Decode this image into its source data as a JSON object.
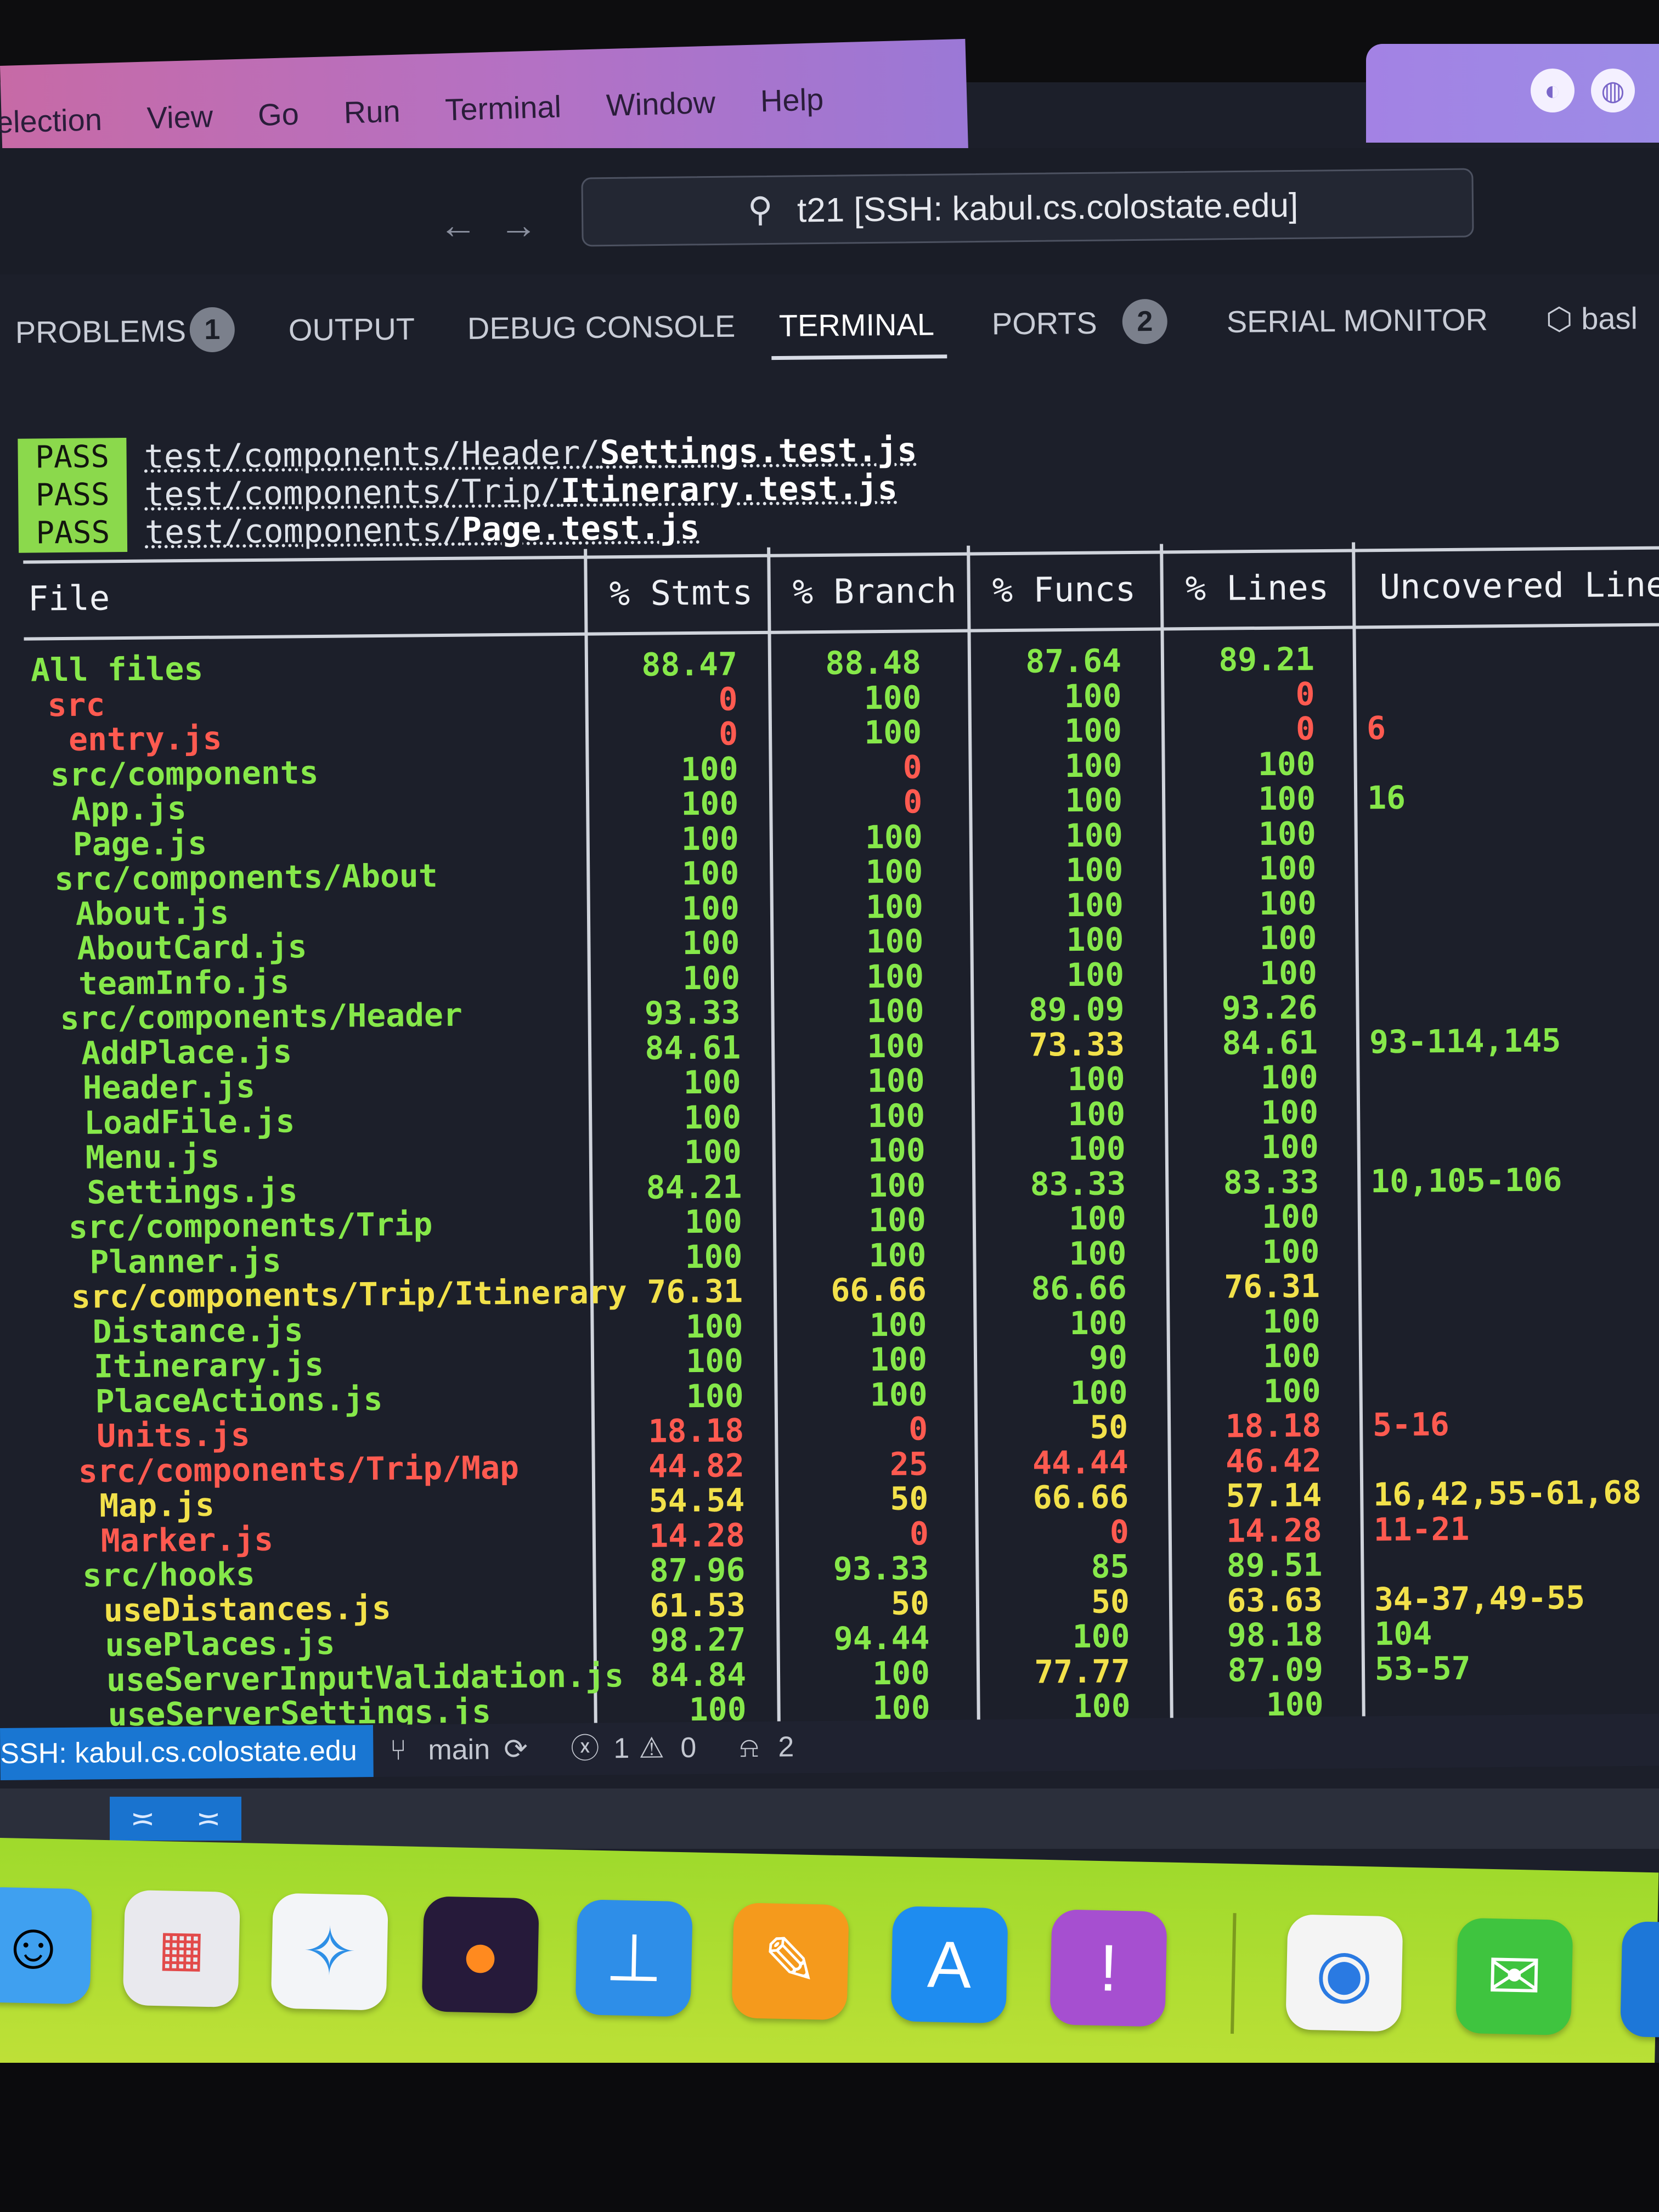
{
  "menubar": {
    "items": [
      "election",
      "View",
      "Go",
      "Run",
      "Terminal",
      "Window",
      "Help"
    ]
  },
  "titlebar": {
    "back_icon": "arrow-left",
    "forward_icon": "arrow-right",
    "command_center": "t21 [SSH: kabul.cs.colostate.edu]"
  },
  "panel": {
    "tabs": [
      {
        "label": "PROBLEMS",
        "badge": "1"
      },
      {
        "label": "OUTPUT"
      },
      {
        "label": "DEBUG CONSOLE"
      },
      {
        "label": "TERMINAL",
        "active": true
      },
      {
        "label": "PORTS",
        "badge": "2"
      },
      {
        "label": "SERIAL MONITOR"
      },
      {
        "label": "basl"
      }
    ]
  },
  "terminal": {
    "pass_label": "PASS",
    "tests": [
      {
        "dir": "test/components/Header/",
        "file": "Settings.test.js"
      },
      {
        "dir": "test/components/Trip/",
        "file": "Itinerary.test.js"
      },
      {
        "dir": "test/components/",
        "file": "Page.test.js"
      }
    ],
    "headers": [
      "File",
      "% Stmts",
      "% Branch",
      "% Funcs",
      "% Lines",
      "Uncovered Line"
    ],
    "colors": {
      "green": "#86e84a",
      "yellow": "#f2e14a",
      "red": "#ff5a50"
    },
    "rows": [
      {
        "file": "All files",
        "stmts": "88.47",
        "branch": "88.48",
        "funcs": "87.64",
        "lines": "89.21",
        "uncovered": "",
        "level": 0
      },
      {
        "file": "src",
        "stmts": "0",
        "branch": "100",
        "funcs": "100",
        "lines": "0",
        "uncovered": "",
        "level": 1
      },
      {
        "file": "entry.js",
        "stmts": "0",
        "branch": "100",
        "funcs": "100",
        "lines": "0",
        "uncovered": "6",
        "level": 2
      },
      {
        "file": "src/components",
        "stmts": "100",
        "branch": "0",
        "funcs": "100",
        "lines": "100",
        "uncovered": "",
        "level": 1
      },
      {
        "file": "App.js",
        "stmts": "100",
        "branch": "0",
        "funcs": "100",
        "lines": "100",
        "uncovered": "16",
        "level": 2
      },
      {
        "file": "Page.js",
        "stmts": "100",
        "branch": "100",
        "funcs": "100",
        "lines": "100",
        "uncovered": "",
        "level": 2
      },
      {
        "file": "src/components/About",
        "stmts": "100",
        "branch": "100",
        "funcs": "100",
        "lines": "100",
        "uncovered": "",
        "level": 1
      },
      {
        "file": "About.js",
        "stmts": "100",
        "branch": "100",
        "funcs": "100",
        "lines": "100",
        "uncovered": "",
        "level": 2
      },
      {
        "file": "AboutCard.js",
        "stmts": "100",
        "branch": "100",
        "funcs": "100",
        "lines": "100",
        "uncovered": "",
        "level": 2
      },
      {
        "file": "teamInfo.js",
        "stmts": "100",
        "branch": "100",
        "funcs": "100",
        "lines": "100",
        "uncovered": "",
        "level": 2
      },
      {
        "file": "src/components/Header",
        "stmts": "93.33",
        "branch": "100",
        "funcs": "89.09",
        "lines": "93.26",
        "uncovered": "",
        "level": 1
      },
      {
        "file": "AddPlace.js",
        "stmts": "84.61",
        "branch": "100",
        "funcs": "73.33",
        "lines": "84.61",
        "uncovered": "93-114,145",
        "level": 2
      },
      {
        "file": "Header.js",
        "stmts": "100",
        "branch": "100",
        "funcs": "100",
        "lines": "100",
        "uncovered": "",
        "level": 2
      },
      {
        "file": "LoadFile.js",
        "stmts": "100",
        "branch": "100",
        "funcs": "100",
        "lines": "100",
        "uncovered": "",
        "level": 2
      },
      {
        "file": "Menu.js",
        "stmts": "100",
        "branch": "100",
        "funcs": "100",
        "lines": "100",
        "uncovered": "",
        "level": 2
      },
      {
        "file": "Settings.js",
        "stmts": "84.21",
        "branch": "100",
        "funcs": "83.33",
        "lines": "83.33",
        "uncovered": "10,105-106",
        "level": 2
      },
      {
        "file": "src/components/Trip",
        "stmts": "100",
        "branch": "100",
        "funcs": "100",
        "lines": "100",
        "uncovered": "",
        "level": 1
      },
      {
        "file": "Planner.js",
        "stmts": "100",
        "branch": "100",
        "funcs": "100",
        "lines": "100",
        "uncovered": "",
        "level": 2
      },
      {
        "file": "src/components/Trip/Itinerary",
        "stmts": "76.31",
        "branch": "66.66",
        "funcs": "86.66",
        "lines": "76.31",
        "uncovered": "",
        "level": 1
      },
      {
        "file": "Distance.js",
        "stmts": "100",
        "branch": "100",
        "funcs": "100",
        "lines": "100",
        "uncovered": "",
        "level": 2
      },
      {
        "file": "Itinerary.js",
        "stmts": "100",
        "branch": "100",
        "funcs": "90",
        "lines": "100",
        "uncovered": "",
        "level": 2
      },
      {
        "file": "PlaceActions.js",
        "stmts": "100",
        "branch": "100",
        "funcs": "100",
        "lines": "100",
        "uncovered": "",
        "level": 2
      },
      {
        "file": "Units.js",
        "stmts": "18.18",
        "branch": "0",
        "funcs": "50",
        "lines": "18.18",
        "uncovered": "5-16",
        "level": 2
      },
      {
        "file": "src/components/Trip/Map",
        "stmts": "44.82",
        "branch": "25",
        "funcs": "44.44",
        "lines": "46.42",
        "uncovered": "",
        "level": 1
      },
      {
        "file": "Map.js",
        "stmts": "54.54",
        "branch": "50",
        "funcs": "66.66",
        "lines": "57.14",
        "uncovered": "16,42,55-61,68",
        "level": 2
      },
      {
        "file": "Marker.js",
        "stmts": "14.28",
        "branch": "0",
        "funcs": "0",
        "lines": "14.28",
        "uncovered": "11-21",
        "level": 2
      },
      {
        "file": "src/hooks",
        "stmts": "87.96",
        "branch": "93.33",
        "funcs": "85",
        "lines": "89.51",
        "uncovered": "",
        "level": 1
      },
      {
        "file": "useDistances.js",
        "stmts": "61.53",
        "branch": "50",
        "funcs": "50",
        "lines": "63.63",
        "uncovered": "34-37,49-55",
        "level": 2
      },
      {
        "file": "usePlaces.js",
        "stmts": "98.27",
        "branch": "94.44",
        "funcs": "100",
        "lines": "98.18",
        "uncovered": "104",
        "level": 2
      },
      {
        "file": "useServerInputValidation.js",
        "stmts": "84.84",
        "branch": "100",
        "funcs": "77.77",
        "lines": "87.09",
        "uncovered": "53-57",
        "level": 2
      },
      {
        "file": "useServerSettings.js",
        "stmts": "100",
        "branch": "100",
        "funcs": "100",
        "lines": "100",
        "uncovered": "",
        "level": 2
      }
    ]
  },
  "statusbar": {
    "remote": "SSH: kabul.cs.colostate.edu",
    "branch": "main",
    "errors": "1",
    "warnings": "0",
    "ports": "2"
  },
  "dock": {
    "apps": [
      "finder-icon",
      "launchpad-icon",
      "safari-icon",
      "firefox-icon",
      "keynote-icon",
      "pages-icon",
      "app-store-icon",
      "feedback-icon",
      "chrome-icon",
      "wechat-icon"
    ]
  }
}
